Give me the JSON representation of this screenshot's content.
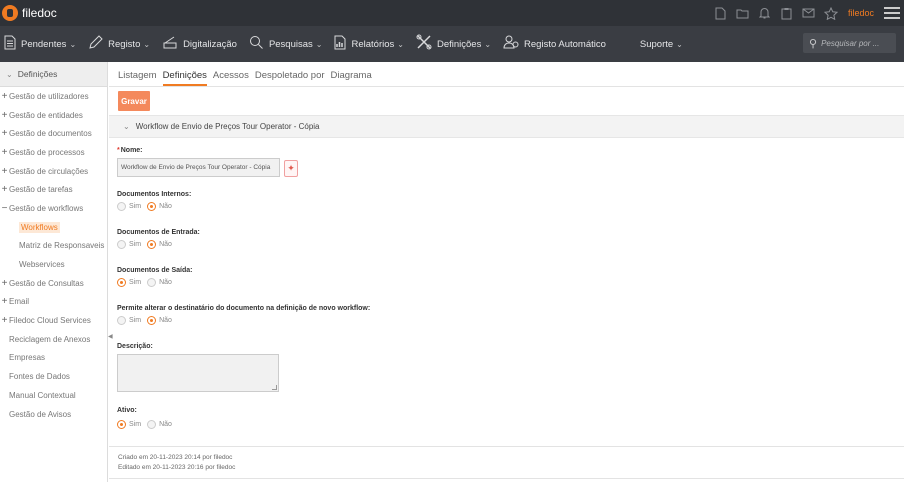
{
  "app": {
    "name": "filedoc",
    "user": "filedoc"
  },
  "topbar": {
    "icons": [
      "document-icon",
      "folder-icon",
      "bell-icon",
      "clipboard-icon",
      "mail-icon",
      "star-icon"
    ]
  },
  "menu": {
    "items": [
      {
        "label": "Pendentes",
        "icon": "document-icon",
        "caret": true
      },
      {
        "label": "Registo",
        "icon": "pencil-icon",
        "caret": true
      },
      {
        "label": "Digitalização",
        "icon": "scanner-icon",
        "caret": false
      },
      {
        "label": "Pesquisas",
        "icon": "search-icon",
        "caret": true
      },
      {
        "label": "Relatórios",
        "icon": "report-icon",
        "caret": true
      },
      {
        "label": "Definições",
        "icon": "tools-icon",
        "caret": true
      },
      {
        "label": "Registo Automático",
        "icon": "auto-register-icon",
        "caret": false
      },
      {
        "label": "Suporte",
        "icon": "",
        "caret": true
      }
    ],
    "search_placeholder": "Pesquisar por ..."
  },
  "sidebar": {
    "header": "Definições",
    "items": [
      {
        "label": "Gestão de utilizadores",
        "exp": "+"
      },
      {
        "label": "Gestão de entidades",
        "exp": "+"
      },
      {
        "label": "Gestão de documentos",
        "exp": "+"
      },
      {
        "label": "Gestão de processos",
        "exp": "+"
      },
      {
        "label": "Gestão de circulações",
        "exp": "+"
      },
      {
        "label": "Gestão de tarefas",
        "exp": "+"
      },
      {
        "label": "Gestão de workflows",
        "exp": "−"
      },
      {
        "label": "Workflows",
        "exp": "",
        "sub": true,
        "active": true
      },
      {
        "label": "Matriz de Responsaveis",
        "exp": "",
        "sub": true
      },
      {
        "label": "Webservices",
        "exp": "",
        "sub": true
      },
      {
        "label": "Gestão de Consultas",
        "exp": "+"
      },
      {
        "label": "Email",
        "exp": "+"
      },
      {
        "label": "Filedoc Cloud Services",
        "exp": "+"
      },
      {
        "label": "Reciclagem de Anexos",
        "exp": ""
      },
      {
        "label": "Empresas",
        "exp": ""
      },
      {
        "label": "Fontes de Dados",
        "exp": ""
      },
      {
        "label": "Manual Contextual",
        "exp": ""
      },
      {
        "label": "Gestão de Avisos",
        "exp": ""
      }
    ]
  },
  "tabs": [
    {
      "label": "Listagem",
      "active": false
    },
    {
      "label": "Definições",
      "active": true
    },
    {
      "label": "Acessos",
      "active": false
    },
    {
      "label": "Despoletado por",
      "active": false
    },
    {
      "label": "Diagrama",
      "active": false
    }
  ],
  "toolbar": {
    "save_label": "Gravar"
  },
  "section": {
    "title": "Workflow de Envio de Preços Tour Operator - Cópia"
  },
  "form": {
    "name_label": "Nome:",
    "name_value": "Workflow de Envio de Preços Tour Operator - Cópia",
    "internal_label": "Documentos Internos:",
    "entry_label": "Documentos de Entrada:",
    "exit_label": "Documentos de Saída:",
    "change_dest_label": "Permite alterar o destinatário do documento na definição de novo workflow:",
    "description_label": "Descrição:",
    "active_label": "Ativo:",
    "yes": "Sim",
    "no": "Não",
    "values": {
      "internal": "no",
      "entry": "no",
      "exit": "yes",
      "change_dest": "no",
      "active": "yes"
    }
  },
  "footer": {
    "created": "Criado em 20-11-2023 20:14 por filedoc",
    "edited": "Editado em 20-11-2023 20:16 por filedoc"
  }
}
